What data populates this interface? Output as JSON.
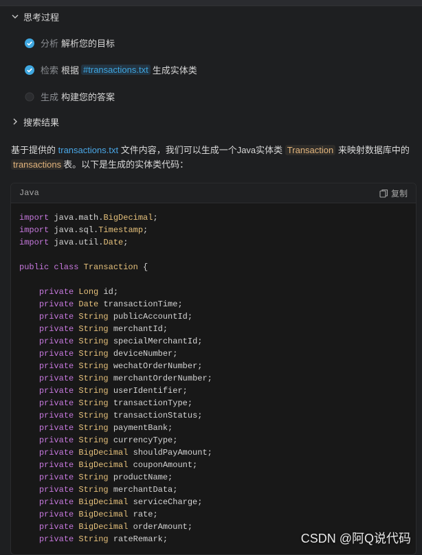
{
  "thinking": {
    "header": "思考过程",
    "steps": [
      {
        "label": "分析",
        "text": "解析您的目标",
        "status": "done"
      },
      {
        "label": "检索",
        "pre": "根据",
        "tag": "#transactions.txt",
        "post": "生成实体类",
        "status": "done"
      },
      {
        "label": "生成",
        "text": "构建您的答案",
        "status": "pending"
      }
    ]
  },
  "search_results": {
    "header": "搜索结果"
  },
  "answer": {
    "p1": "基于提供的",
    "file": "transactions.txt",
    "p2": "文件内容，我们可以生成一个Java实体类",
    "class_name": "Transaction",
    "p3": "来映射数据库中的",
    "table": "transactions",
    "p4": "表。以下是生成的实体类代码："
  },
  "code_block": {
    "language": "Java",
    "copy_label": "复制",
    "lines": [
      [
        [
          "kw",
          "import "
        ],
        [
          "pl",
          "java.math."
        ],
        [
          "ty",
          "BigDecimal"
        ],
        [
          "pl",
          ";"
        ]
      ],
      [
        [
          "kw",
          "import "
        ],
        [
          "pl",
          "java.sql."
        ],
        [
          "ty",
          "Timestamp"
        ],
        [
          "pl",
          ";"
        ]
      ],
      [
        [
          "kw",
          "import "
        ],
        [
          "pl",
          "java.util."
        ],
        [
          "ty",
          "Date"
        ],
        [
          "pl",
          ";"
        ]
      ],
      [],
      [
        [
          "kw",
          "public class "
        ],
        [
          "ty",
          "Transaction"
        ],
        [
          "pl",
          " {"
        ]
      ],
      [],
      [
        [
          "pl",
          "    "
        ],
        [
          "kw",
          "private "
        ],
        [
          "ty",
          "Long "
        ],
        [
          "pl",
          "id;"
        ]
      ],
      [
        [
          "pl",
          "    "
        ],
        [
          "kw",
          "private "
        ],
        [
          "ty",
          "Date "
        ],
        [
          "pl",
          "transactionTime;"
        ]
      ],
      [
        [
          "pl",
          "    "
        ],
        [
          "kw",
          "private "
        ],
        [
          "ty",
          "String "
        ],
        [
          "pl",
          "publicAccountId;"
        ]
      ],
      [
        [
          "pl",
          "    "
        ],
        [
          "kw",
          "private "
        ],
        [
          "ty",
          "String "
        ],
        [
          "pl",
          "merchantId;"
        ]
      ],
      [
        [
          "pl",
          "    "
        ],
        [
          "kw",
          "private "
        ],
        [
          "ty",
          "String "
        ],
        [
          "pl",
          "specialMerchantId;"
        ]
      ],
      [
        [
          "pl",
          "    "
        ],
        [
          "kw",
          "private "
        ],
        [
          "ty",
          "String "
        ],
        [
          "pl",
          "deviceNumber;"
        ]
      ],
      [
        [
          "pl",
          "    "
        ],
        [
          "kw",
          "private "
        ],
        [
          "ty",
          "String "
        ],
        [
          "pl",
          "wechatOrderNumber;"
        ]
      ],
      [
        [
          "pl",
          "    "
        ],
        [
          "kw",
          "private "
        ],
        [
          "ty",
          "String "
        ],
        [
          "pl",
          "merchantOrderNumber;"
        ]
      ],
      [
        [
          "pl",
          "    "
        ],
        [
          "kw",
          "private "
        ],
        [
          "ty",
          "String "
        ],
        [
          "pl",
          "userIdentifier;"
        ]
      ],
      [
        [
          "pl",
          "    "
        ],
        [
          "kw",
          "private "
        ],
        [
          "ty",
          "String "
        ],
        [
          "pl",
          "transactionType;"
        ]
      ],
      [
        [
          "pl",
          "    "
        ],
        [
          "kw",
          "private "
        ],
        [
          "ty",
          "String "
        ],
        [
          "pl",
          "transactionStatus;"
        ]
      ],
      [
        [
          "pl",
          "    "
        ],
        [
          "kw",
          "private "
        ],
        [
          "ty",
          "String "
        ],
        [
          "pl",
          "paymentBank;"
        ]
      ],
      [
        [
          "pl",
          "    "
        ],
        [
          "kw",
          "private "
        ],
        [
          "ty",
          "String "
        ],
        [
          "pl",
          "currencyType;"
        ]
      ],
      [
        [
          "pl",
          "    "
        ],
        [
          "kw",
          "private "
        ],
        [
          "ty",
          "BigDecimal "
        ],
        [
          "pl",
          "shouldPayAmount;"
        ]
      ],
      [
        [
          "pl",
          "    "
        ],
        [
          "kw",
          "private "
        ],
        [
          "ty",
          "BigDecimal "
        ],
        [
          "pl",
          "couponAmount;"
        ]
      ],
      [
        [
          "pl",
          "    "
        ],
        [
          "kw",
          "private "
        ],
        [
          "ty",
          "String "
        ],
        [
          "pl",
          "productName;"
        ]
      ],
      [
        [
          "pl",
          "    "
        ],
        [
          "kw",
          "private "
        ],
        [
          "ty",
          "String "
        ],
        [
          "pl",
          "merchantData;"
        ]
      ],
      [
        [
          "pl",
          "    "
        ],
        [
          "kw",
          "private "
        ],
        [
          "ty",
          "BigDecimal "
        ],
        [
          "pl",
          "serviceCharge;"
        ]
      ],
      [
        [
          "pl",
          "    "
        ],
        [
          "kw",
          "private "
        ],
        [
          "ty",
          "BigDecimal "
        ],
        [
          "pl",
          "rate;"
        ]
      ],
      [
        [
          "pl",
          "    "
        ],
        [
          "kw",
          "private "
        ],
        [
          "ty",
          "BigDecimal "
        ],
        [
          "pl",
          "orderAmount;"
        ]
      ],
      [
        [
          "pl",
          "    "
        ],
        [
          "kw",
          "private "
        ],
        [
          "ty",
          "String "
        ],
        [
          "pl",
          "rateRemark;"
        ]
      ]
    ]
  },
  "watermark": "CSDN @阿Q说代码",
  "colors": {
    "check": "#3fa7e0",
    "keyword": "#c678dd",
    "type": "#e5c07b"
  }
}
